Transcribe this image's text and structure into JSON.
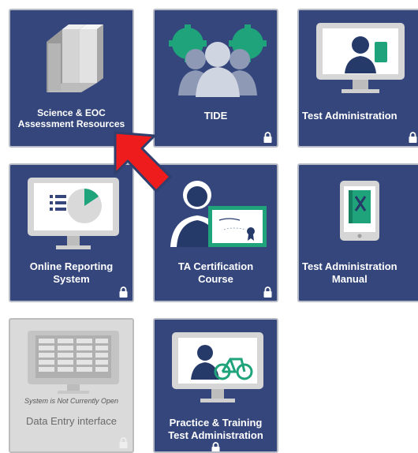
{
  "tiles": {
    "science": {
      "line1": "Science & EOC",
      "line2": "Assessment Resources"
    },
    "tide": {
      "label": "TIDE"
    },
    "test_admin": {
      "label": "Test Administration"
    },
    "ors": {
      "line1": "Online Reporting",
      "line2": "System"
    },
    "ta_cert": {
      "line1": "TA Certification",
      "line2": "Course"
    },
    "ta_manual": {
      "line1": "Test Administration",
      "line2": "Manual"
    },
    "data_entry": {
      "status": "System is Not Currently Open",
      "label": "Data Entry interface"
    },
    "practice": {
      "line1": "Practice & Training",
      "line2": "Test Administration"
    }
  },
  "colors": {
    "tile_bg": "#34467c",
    "tile_disabled_bg": "#dadada",
    "accent_green": "#1fa37a",
    "arrow_red": "#ee1c1c"
  },
  "icons": [
    "books-icon",
    "people-group-icon",
    "monitor-user-icon",
    "monitor-chart-icon",
    "certificate-user-icon",
    "tablet-book-icon",
    "monitor-table-icon",
    "monitor-bike-icon",
    "lock-icon",
    "red-arrow-icon"
  ]
}
